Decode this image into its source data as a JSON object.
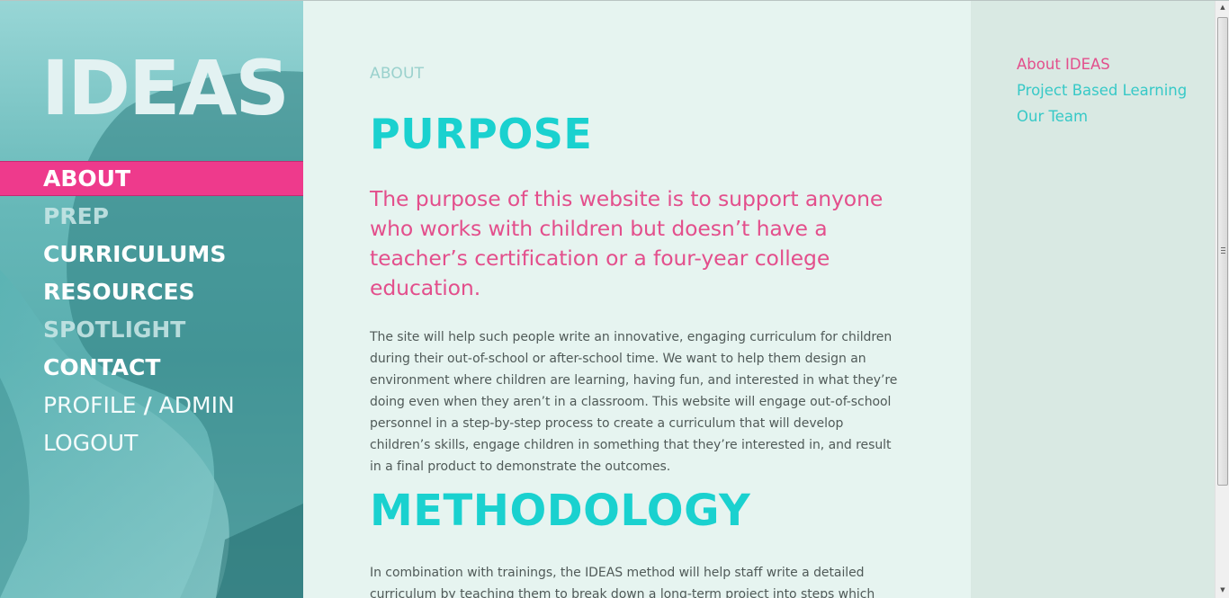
{
  "sidebar": {
    "logo": "IDEAS",
    "nav": [
      {
        "label": "ABOUT",
        "state": "active"
      },
      {
        "label": "PREP",
        "state": "disabled"
      },
      {
        "label": "CURRICULUMS",
        "state": "normal"
      },
      {
        "label": "RESOURCES",
        "state": "normal"
      },
      {
        "label": "SPOTLIGHT",
        "state": "disabled"
      },
      {
        "label": "CONTACT",
        "state": "normal"
      }
    ],
    "profile_label": "PROFILE",
    "profile_separator": "/",
    "admin_label": "ADMIN",
    "logout_label": "LOGOUT"
  },
  "main": {
    "eyebrow": "ABOUT",
    "purpose_heading": "PURPOSE",
    "purpose_lead": "The purpose of this website is to support anyone who works with children but doesn’t have a teacher’s certification or a four-year college education.",
    "purpose_body": "The site will help such people write an innovative, engaging curriculum for children during their out-of-school or after-school time. We want to help them design an environment where children are learning, having fun, and interested in what they’re doing even when they aren’t in a classroom. This website will engage out-of-school personnel in a step-by-step process to create a curriculum that will develop children’s skills, engage children in something that they’re interested in, and result in a final product to demonstrate the outcomes.",
    "methodology_heading": "METHODOLOGY",
    "methodology_body": "In combination with trainings, the IDEAS method will help staff write a detailed curriculum by teaching them to break down a long-term project into steps which focus"
  },
  "aside": {
    "links": [
      {
        "label": "About IDEAS",
        "active": true
      },
      {
        "label": "Project Based Learning",
        "active": false
      },
      {
        "label": "Our Team",
        "active": false
      }
    ]
  },
  "colors": {
    "accent_pink": "#ee3a8c",
    "heading_teal": "#1ad1cf",
    "lead_pink": "#e34f8c",
    "main_bg": "#e6f4f0",
    "aside_bg": "#d9e9e3"
  },
  "icons": {
    "scroll_up": "scroll-up-arrow-icon",
    "scroll_down": "scroll-down-arrow-icon"
  }
}
